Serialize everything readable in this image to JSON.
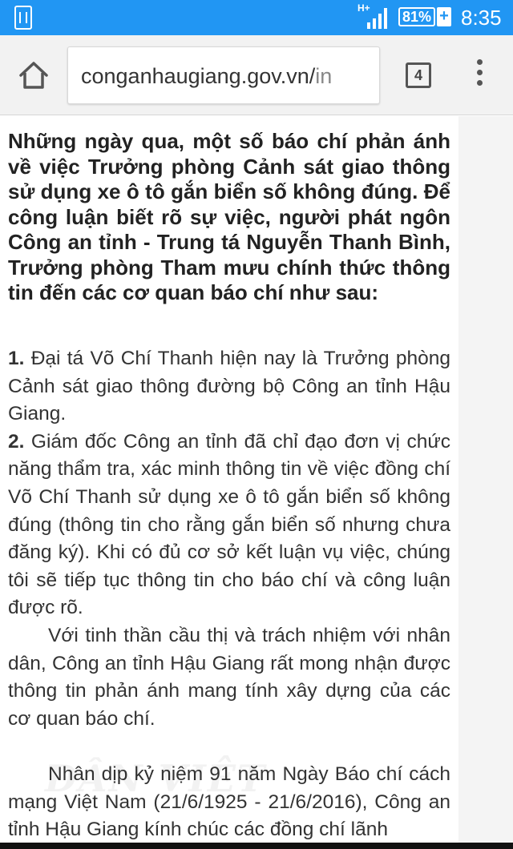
{
  "status_bar": {
    "network": "H+",
    "battery": "81%",
    "charging": "+",
    "time": "8:35"
  },
  "browser": {
    "url_host": "conganhaugiang.gov.vn/",
    "url_path": "in",
    "tab_count": "4"
  },
  "article": {
    "lead": "Những ngày qua, một số báo chí phản ánh về việc Trưởng phòng Cảnh sát giao thông sử dụng xe ô tô gắn biển số không đúng. Để công luận biết rõ sự việc, người phát ngôn Công an tỉnh - Trung tá Nguyễn Thanh Bình, Trưởng phòng Tham mưu chính thức thông tin đến các cơ quan báo chí như sau:",
    "p1_num": "1.",
    "p1": "Đại tá Võ Chí Thanh hiện nay là Trưởng phòng Cảnh sát giao thông đường bộ Công an tỉnh Hậu Giang.",
    "p2_num": "2.",
    "p2": "Giám đốc Công an tỉnh đã chỉ đạo đơn vị chức năng thẩm tra, xác minh thông tin về việc đồng chí Võ Chí Thanh sử dụng xe ô tô gắn biển số không đúng (thông tin cho rằng gắn biển số nhưng chưa đăng ký). Khi có đủ cơ sở kết luận vụ việc, chúng tôi sẽ tiếp tục thông tin cho báo chí và công luận được rõ.",
    "p3": "Với tinh thần cầu thị và trách nhiệm với nhân dân, Công an tỉnh Hậu Giang rất mong nhận được thông tin phản ánh mang tính xây dựng của các cơ quan báo chí.",
    "p4": "Nhân dịp kỷ niệm 91 năm Ngày Báo chí cách mạng Việt Nam (21/6/1925 - 21/6/2016), Công an tỉnh Hậu Giang kính chúc các đồng chí lãnh"
  },
  "watermark": "DÂN VIỆT"
}
